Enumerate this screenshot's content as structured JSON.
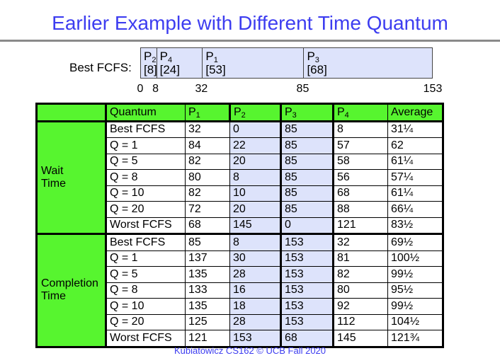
{
  "title": "Earlier Example with Different Time Quantum",
  "gantt": {
    "label": "Best FCFS:",
    "segments": [
      {
        "process": "P",
        "sub": "2",
        "burst": "[8]",
        "start": 0,
        "end": 8
      },
      {
        "process": "P",
        "sub": "4",
        "burst": "[24]",
        "start": 8,
        "end": 32
      },
      {
        "process": "P",
        "sub": "1",
        "burst": "[53]",
        "start": 32,
        "end": 85
      },
      {
        "process": "P",
        "sub": "3",
        "burst": "[68]",
        "start": 85,
        "end": 153
      }
    ],
    "ticks": [
      "0",
      "8",
      "32",
      "85",
      "153"
    ]
  },
  "table": {
    "headers": {
      "quantum": "Quantum",
      "p1": "P",
      "p1_sub": "1",
      "p2": "P",
      "p2_sub": "2",
      "p3": "P",
      "p3_sub": "3",
      "p4": "P",
      "p4_sub": "4",
      "average": "Average"
    },
    "groups": [
      {
        "label_line1": "Wait",
        "label_line2": "Time",
        "rows": [
          {
            "quantum": "Best FCFS",
            "p1": "32",
            "p2": "0",
            "p3": "85",
            "p4": "8",
            "average": "31¼"
          },
          {
            "quantum": "Q = 1",
            "p1": "84",
            "p2": "22",
            "p3": "85",
            "p4": "57",
            "average": "62"
          },
          {
            "quantum": "Q = 5",
            "p1": "82",
            "p2": "20",
            "p3": "85",
            "p4": "58",
            "average": "61¼"
          },
          {
            "quantum": "Q = 8",
            "p1": "80",
            "p2": "8",
            "p3": "85",
            "p4": "56",
            "average": "57¼"
          },
          {
            "quantum": "Q = 10",
            "p1": "82",
            "p2": "10",
            "p3": "85",
            "p4": "68",
            "average": "61¼"
          },
          {
            "quantum": "Q = 20",
            "p1": "72",
            "p2": "20",
            "p3": "85",
            "p4": "88",
            "average": "66¼"
          },
          {
            "quantum": "Worst FCFS",
            "p1": "68",
            "p2": "145",
            "p3": "0",
            "p4": "121",
            "average": "83½"
          }
        ]
      },
      {
        "label_line1": "Completion",
        "label_line2": "Time",
        "rows": [
          {
            "quantum": "Best FCFS",
            "p1": "85",
            "p2": "8",
            "p3": "153",
            "p4": "32",
            "average": "69½"
          },
          {
            "quantum": "Q = 1",
            "p1": "137",
            "p2": "30",
            "p3": "153",
            "p4": "81",
            "average": "100½"
          },
          {
            "quantum": "Q = 5",
            "p1": "135",
            "p2": "28",
            "p3": "153",
            "p4": "82",
            "average": "99½"
          },
          {
            "quantum": "Q = 8",
            "p1": "133",
            "p2": "16",
            "p3": "153",
            "p4": "80",
            "average": "95½"
          },
          {
            "quantum": "Q = 10",
            "p1": "135",
            "p2": "18",
            "p3": "153",
            "p4": "92",
            "average": "99½"
          },
          {
            "quantum": "Q = 20",
            "p1": "125",
            "p2": "28",
            "p3": "153",
            "p4": "112",
            "average": "104½"
          },
          {
            "quantum": "Worst FCFS",
            "p1": "121",
            "p2": "153",
            "p3": "68",
            "p4": "145",
            "average": "121¾"
          }
        ]
      }
    ]
  },
  "colors": {
    "title": "#3d3df0",
    "header_green": "#57f52f",
    "highlight_blue": "#dde3fb"
  },
  "footer": "Kubiatowicz CS162 © UCB Fall 2020"
}
